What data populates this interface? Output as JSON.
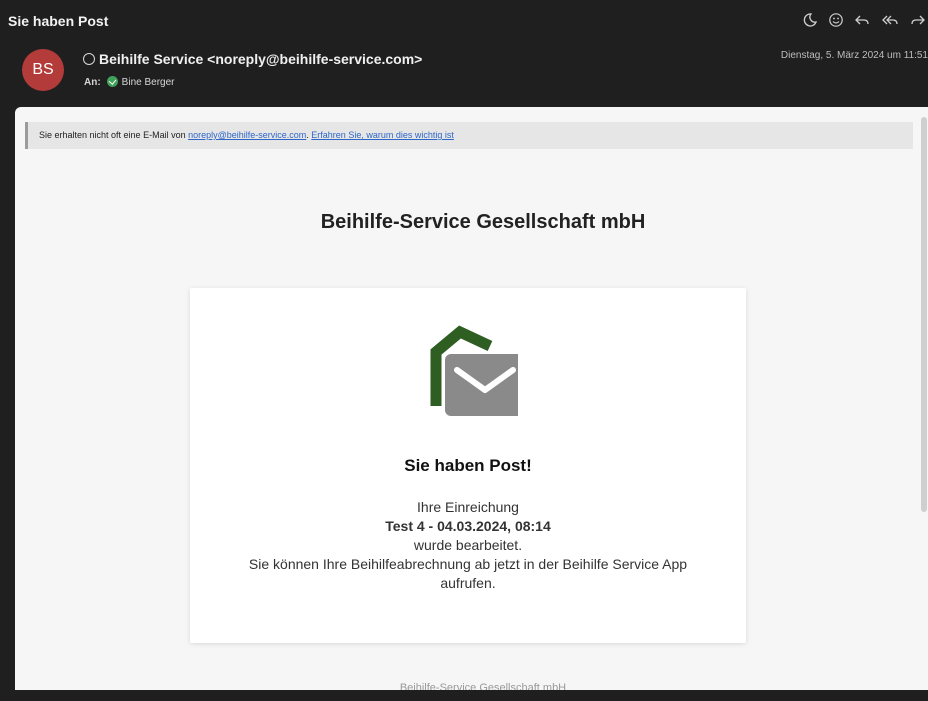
{
  "window": {
    "subject": "Sie haben Post"
  },
  "toolbar": {
    "actions": [
      {
        "name": "moon-icon",
        "glyph": "☽"
      },
      {
        "name": "emoji-icon",
        "glyph": "☺"
      },
      {
        "name": "reply-icon",
        "glyph": "↶"
      },
      {
        "name": "reply-all-icon",
        "glyph": "↞"
      },
      {
        "name": "forward-icon",
        "glyph": "↷"
      }
    ]
  },
  "header": {
    "avatar_initials": "BS",
    "sender": "Beihilfe Service <noreply@beihilfe-service.com>",
    "to_label": "An:",
    "recipient": "Bine Berger",
    "date": "Dienstag, 5. März 2024 um 11:51"
  },
  "notice": {
    "text": "Sie erhalten nicht oft eine E-Mail von ",
    "link_email": "noreply@beihilfe-service.com",
    "separator": ". ",
    "link_learn": "Erfahren Sie, warum dies wichtig ist"
  },
  "email": {
    "company": "Beihilfe-Service Gesellschaft mbH",
    "card_title": "Sie haben Post!",
    "line1": "Ihre Einreichung",
    "line2": "Test 4 - 04.03.2024, 08:14",
    "line3": "wurde bearbeitet.",
    "line4": "Sie können Ihre Beihilfeabrechnung ab jetzt in der Beihilfe Service App",
    "line5": "aufrufen.",
    "footer": "Beihilfe-Service Gesellschaft mbH"
  },
  "colors": {
    "avatar": "#b33b3a",
    "logo_green": "#2e5e22",
    "envelope_grey": "#8a8a8a",
    "link": "#2e66c8"
  }
}
